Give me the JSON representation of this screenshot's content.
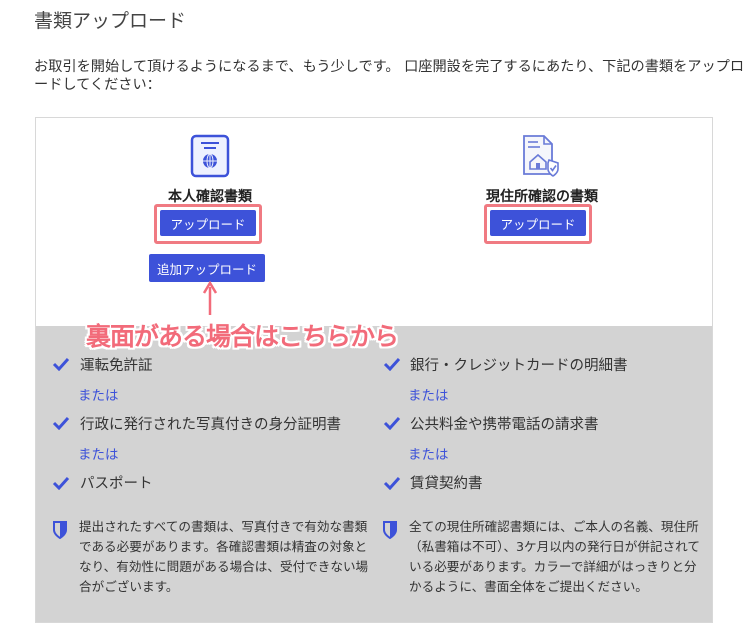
{
  "page": {
    "title": "書類アップロード",
    "intro": "お取引を開始して頂けるようになるまで、もう少しです。 口座開設を完了するにあたり、下記の書類をアップロードしてください："
  },
  "identity": {
    "title": "本人確認書類",
    "upload_label": "アップロード",
    "add_upload_label": "追加アップロード",
    "annotation": "裏面がある場合はこちらから",
    "items": [
      "運転免許証",
      "行政に発行された写真付きの身分証明書",
      "パスポート"
    ],
    "or_label": "または",
    "note": "提出されたすべての書類は、写真付きで有効な書類である必要があります。各確認書類は精査の対象となり、有効性に問題がある場合は、受付できない場合がございます。"
  },
  "address": {
    "title": "現住所確認の書類",
    "upload_label": "アップロード",
    "items": [
      "銀行・クレジットカードの明細書",
      "公共料金や携帯電話の請求書",
      "賃貸契約書"
    ],
    "or_label": "または",
    "note": "全ての現住所確認書類には、ご本人の名義、現住所（私書箱は不可）、3ケ月以内の発行日が併記されている必要があります。カラーで詳細がはっきりと分かるように、書面全体をご提出ください。"
  },
  "colors": {
    "primary": "#3d52d9",
    "highlight": "#f07a82",
    "annotation": "#f26b7a",
    "panel": "#d3d3d3"
  }
}
